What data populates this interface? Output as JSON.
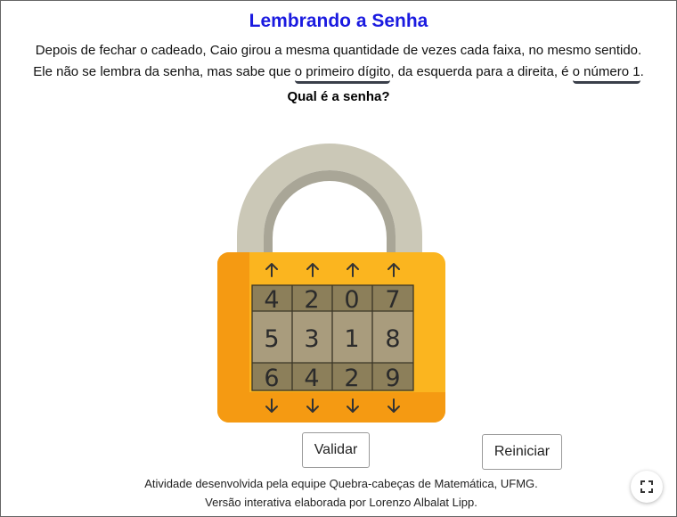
{
  "title": "Lembrando a Senha",
  "instructions": {
    "line1": "Depois de fechar o cadeado, Caio girou a mesma quantidade de vezes cada faixa, no mesmo sentido.",
    "line2_a": "Ele não se lembra da senha, mas sabe que ",
    "line2_u1": "o primeiro dígito",
    "line2_b": ", da esquerda para a direita, é ",
    "line2_u2": "o número 1",
    "line2_c": ".",
    "question": "Qual é a senha?"
  },
  "lock": {
    "columns": [
      [
        "4",
        "5",
        "6"
      ],
      [
        "2",
        "3",
        "4"
      ],
      [
        "0",
        "1",
        "2"
      ],
      [
        "7",
        "8",
        "9"
      ]
    ],
    "colors": {
      "shackle": "#cbc8b7",
      "shackle_inner": "#a9a697",
      "body": "#fbb51f",
      "body_shadow": "#f59a12",
      "cell_dim": "#8c7f5a",
      "cell_mid": "#a99c7d",
      "cell_border": "#3a3526"
    }
  },
  "buttons": {
    "validar": "Validar",
    "reiniciar": "Reiniciar"
  },
  "credits": {
    "line1": "Atividade desenvolvida pela equipe Quebra-cabeças de Matemática, UFMG.",
    "line2": "Versão interativa elaborada por Lorenzo Albalat Lipp."
  }
}
